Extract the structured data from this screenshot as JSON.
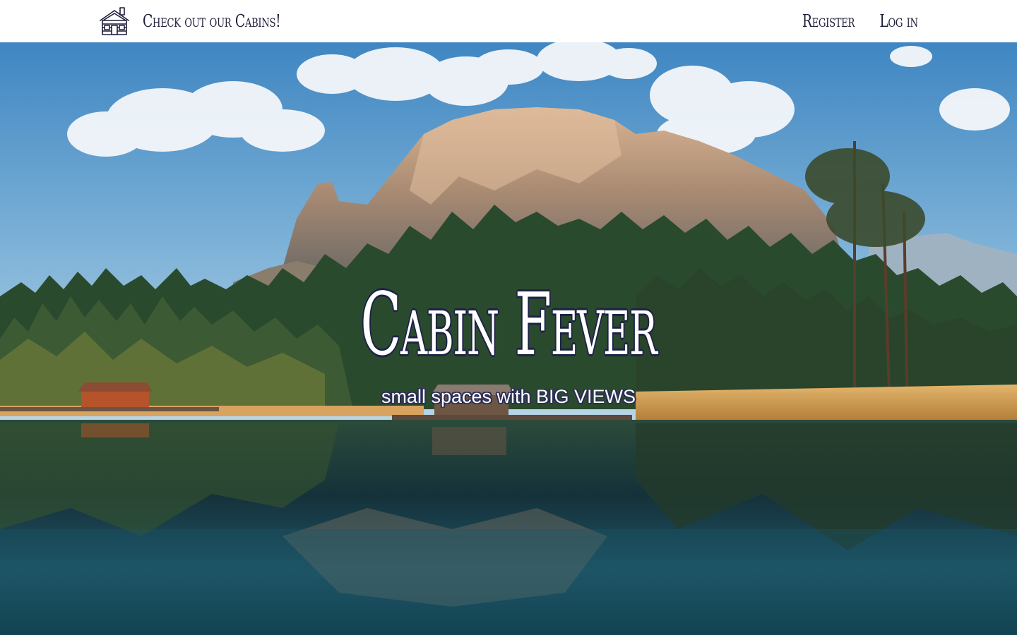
{
  "navbar": {
    "brand_icon": "cabin-icon",
    "brand_label": "Check out our Cabins!",
    "register_label": "Register",
    "login_label": "Log in"
  },
  "hero": {
    "title": "Cabin Fever",
    "subtitle": "small spaces with BIG VIEWS",
    "background": "mountain-lake-forest-landscape"
  },
  "colors": {
    "nav_background": "#ffffff",
    "nav_text": "#1f1f3a",
    "title_text": "#ffffff",
    "title_outline": "#1e2247",
    "sky": "#4a8fc4",
    "water": "#0f3b42",
    "forest": "#1e3b26"
  }
}
